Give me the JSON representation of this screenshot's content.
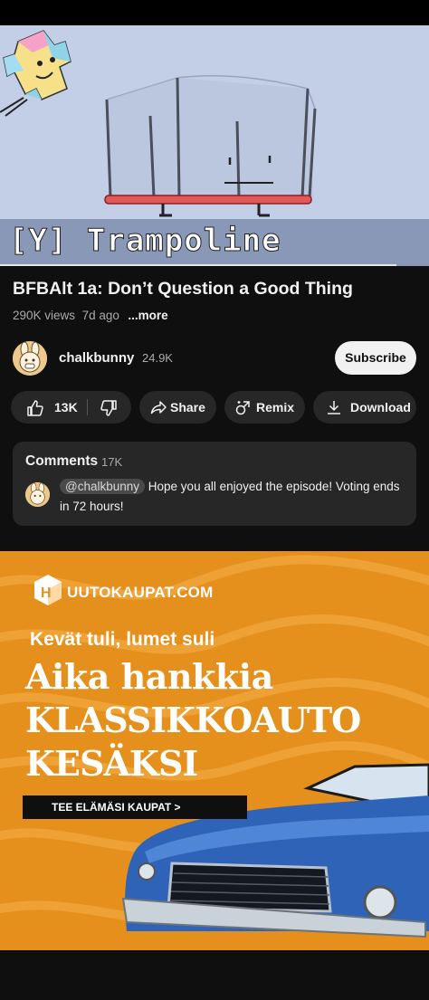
{
  "video": {
    "caption": "[Y] Trampoline"
  },
  "info": {
    "title": "BFBAlt 1a: Don’t Question a Good Thing",
    "views": "290K views",
    "age": "7d ago",
    "more": "...more"
  },
  "channel": {
    "name": "chalkbunny",
    "subscribers": "24.9K",
    "subscribe_label": "Subscribe"
  },
  "actions": {
    "likes": "13K",
    "share": "Share",
    "remix": "Remix",
    "download": "Download"
  },
  "comments": {
    "label": "Comments",
    "count": "17K",
    "mention": "@chalkbunny",
    "text": "Hope you all enjoyed the episode! Voting ends in 72 hours!"
  },
  "ad": {
    "logo": "UUTOKAUPAT.COM",
    "line1": "Kevät tuli, lumet suli",
    "line2": "Aika hankkia",
    "line3": "KLASSIKKOAUTO",
    "line4": "KESÄKSI",
    "cta": "TEE ELÄMÄSI KAUPAT >"
  },
  "colors": {
    "background": "#0f0f0f",
    "chip": "#272727",
    "ad_orange": "#e58f1c",
    "car_blue": "#2f63b8"
  },
  "icons": [
    "thumbs-up-icon",
    "thumbs-down-icon",
    "share-icon",
    "remix-icon",
    "download-icon"
  ]
}
